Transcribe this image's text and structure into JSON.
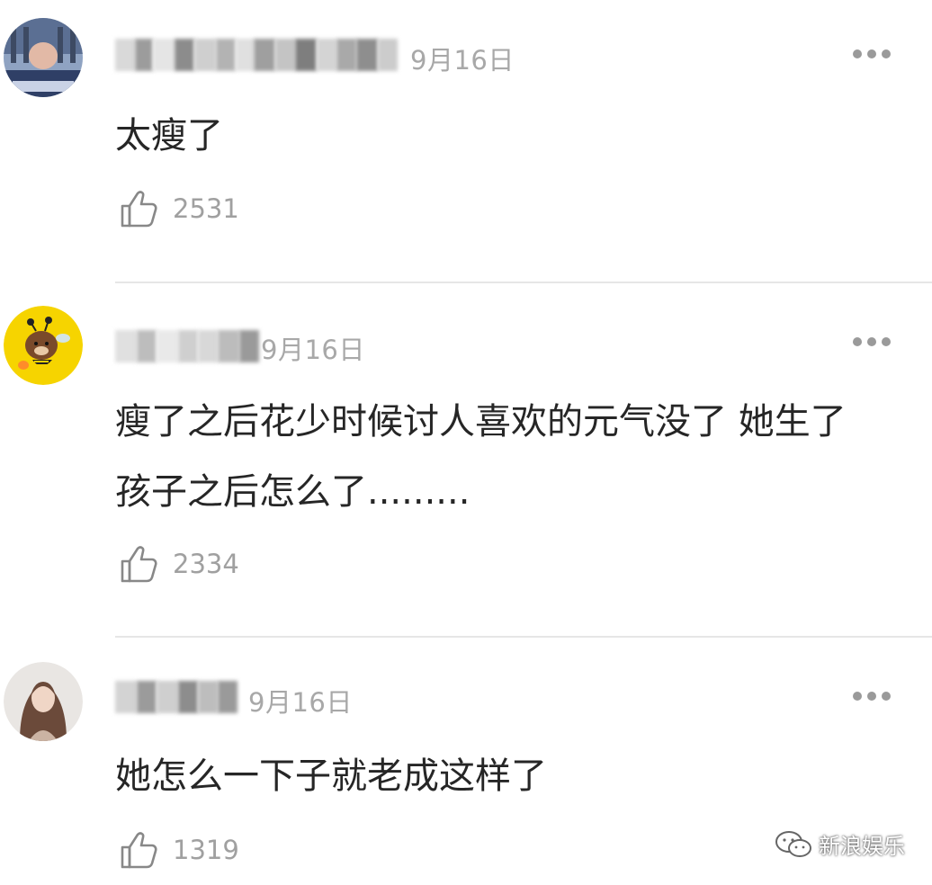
{
  "comments": [
    {
      "date": "9月16日",
      "text": "太瘦了",
      "likes": "2531",
      "avatar_icon": "avatar-photo",
      "more_icon": "more-icon"
    },
    {
      "date": "9月16日",
      "text": "瘦了之后花少时候讨人喜欢的元气没了 她生了孩子之后怎么了.........",
      "likes": "2334",
      "avatar_icon": "avatar-bear",
      "more_icon": "more-icon"
    },
    {
      "date": "9月16日",
      "text": "她怎么一下子就老成这样了",
      "likes": "1319",
      "avatar_icon": "avatar-portrait",
      "more_icon": "more-icon"
    }
  ],
  "watermark": {
    "label": "新浪娱乐",
    "icon": "wechat-icon"
  },
  "colors": {
    "divider": "#e6e6e6",
    "meta_text": "#a8a8a8",
    "body_text": "#262626",
    "bear_avatar_bg": "#f6d400"
  }
}
